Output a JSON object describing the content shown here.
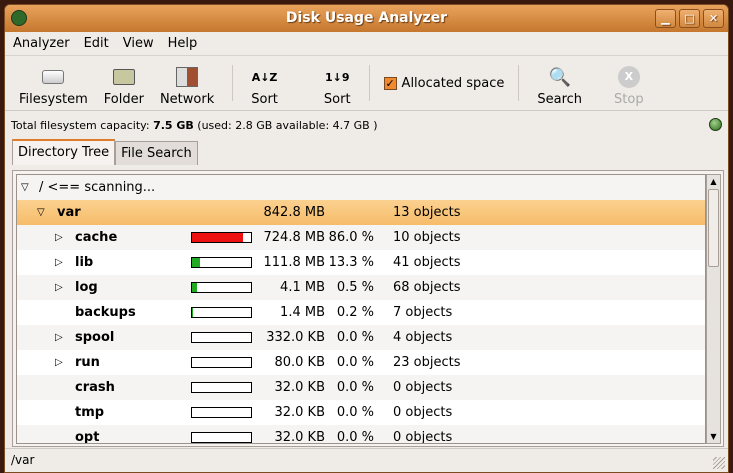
{
  "window": {
    "title": "Disk Usage Analyzer"
  },
  "menu": [
    "Analyzer",
    "Edit",
    "View",
    "Help"
  ],
  "toolbar": {
    "filesystem": "Filesystem",
    "folder": "Folder",
    "network": "Network",
    "sort_az": "Sort",
    "sort_az_glyph": "A↓Z",
    "sort_num": "Sort",
    "sort_num_glyph": "1↓9",
    "allocated": "Allocated space",
    "allocated_checked": true,
    "search": "Search",
    "stop": "Stop"
  },
  "capacity": {
    "label": "Total filesystem capacity:",
    "total": "7.5 GB",
    "detail": "(used: 2.8 GB available: 4.7 GB )"
  },
  "tabs": [
    "Directory Tree",
    "File Search"
  ],
  "root": {
    "label": "/ <== scanning..."
  },
  "var": {
    "name": "var",
    "size": "842.8 MB",
    "objects": "13 objects"
  },
  "rows": [
    {
      "name": "cache",
      "expander": true,
      "size": "724.8 MB",
      "pct": "86.0 %",
      "fraction": 0.86,
      "color": "#ee1111",
      "objects": "10 objects"
    },
    {
      "name": "lib",
      "expander": true,
      "size": "111.8 MB",
      "pct": "13.3 %",
      "fraction": 0.133,
      "color": "#22aa22",
      "objects": "41 objects"
    },
    {
      "name": "log",
      "expander": true,
      "size": "4.1 MB",
      "pct": "0.5 %",
      "fraction": 0.005,
      "color": "#22aa22",
      "objects": "68 objects"
    },
    {
      "name": "backups",
      "expander": false,
      "size": "1.4 MB",
      "pct": "0.2 %",
      "fraction": 0.002,
      "color": "#22aa22",
      "objects": "7 objects"
    },
    {
      "name": "spool",
      "expander": true,
      "size": "332.0 KB",
      "pct": "0.0 %",
      "fraction": 0,
      "color": "#22aa22",
      "objects": "4 objects"
    },
    {
      "name": "run",
      "expander": true,
      "size": "80.0 KB",
      "pct": "0.0 %",
      "fraction": 0,
      "color": "#22aa22",
      "objects": "23 objects"
    },
    {
      "name": "crash",
      "expander": false,
      "size": "32.0 KB",
      "pct": "0.0 %",
      "fraction": 0,
      "color": "#22aa22",
      "objects": "0 objects"
    },
    {
      "name": "tmp",
      "expander": false,
      "size": "32.0 KB",
      "pct": "0.0 %",
      "fraction": 0,
      "color": "#22aa22",
      "objects": "0 objects"
    },
    {
      "name": "opt",
      "expander": false,
      "size": "32.0 KB",
      "pct": "0.0 %",
      "fraction": 0,
      "color": "#22aa22",
      "objects": "0 objects"
    }
  ],
  "status": "/var"
}
